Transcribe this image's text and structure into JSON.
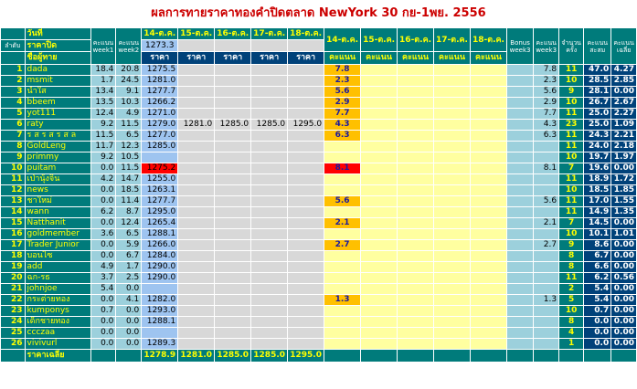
{
  "title": "ผลการทายราคาทองคำปิดตลาด NewYork 30 กย-1พย. 2556",
  "labels": {
    "order": "ลำดับ",
    "day": "วันที่",
    "close_price": "ราคาปิด",
    "player_name": "ชื่อผู้ทาย",
    "score_week1": "คะแนน week1",
    "score_week2": "คะแนน week2",
    "score_week3": "คะแนน week3",
    "bonus_week3": "Bonus week3",
    "count": "จำนวนครั้ง",
    "total": "คะแนนสะสม",
    "average": "คะแนนเฉลี่ย",
    "price": "ราคา",
    "score": "คะแนน",
    "avg_price": "ราคาเฉลี่ย"
  },
  "price_dates": [
    "14-ต.ค.",
    "15-ต.ค.",
    "16-ต.ค.",
    "17-ต.ค.",
    "18-ต.ค."
  ],
  "score_dates": [
    "14-ต.ค.",
    "15-ต.ค.",
    "16-ต.ค.",
    "17-ต.ค.",
    "18-ต.ค."
  ],
  "close_prices": [
    "1273.3",
    "",
    "",
    "",
    ""
  ],
  "avg_prices": [
    "1278.9",
    "1281.0",
    "1285.0",
    "1285.0",
    "1295.0"
  ],
  "rows": [
    {
      "no": "1",
      "name": "dada",
      "w1": "18.4",
      "w2": "20.8",
      "p": [
        "1275.5",
        "",
        "",
        "",
        ""
      ],
      "s": [
        "7.8",
        "",
        "",
        "",
        ""
      ],
      "bonus": "",
      "w3": "7.8",
      "cnt": "11",
      "total": "47.0",
      "avg": "4.27"
    },
    {
      "no": "2",
      "name": "msmit",
      "w1": "1.7",
      "w2": "24.5",
      "p": [
        "1281.0",
        "",
        "",
        "",
        ""
      ],
      "s": [
        "2.3",
        "",
        "",
        "",
        ""
      ],
      "bonus": "",
      "w3": "2.3",
      "cnt": "10",
      "total": "28.5",
      "avg": "2.85"
    },
    {
      "no": "3",
      "name": "น้ำใส",
      "w1": "13.4",
      "w2": "9.1",
      "p": [
        "1277.7",
        "",
        "",
        "",
        ""
      ],
      "s": [
        "5.6",
        "",
        "",
        "",
        ""
      ],
      "bonus": "",
      "w3": "5.6",
      "cnt": "9",
      "total": "28.1",
      "avg": "0.00"
    },
    {
      "no": "4",
      "name": "bbeem",
      "w1": "13.5",
      "w2": "10.3",
      "p": [
        "1266.2",
        "",
        "",
        "",
        ""
      ],
      "s": [
        "2.9",
        "",
        "",
        "",
        ""
      ],
      "bonus": "",
      "w3": "2.9",
      "cnt": "10",
      "total": "26.7",
      "avg": "2.67"
    },
    {
      "no": "5",
      "name": "yot111",
      "w1": "12.4",
      "w2": "4.9",
      "p": [
        "1271.0",
        "",
        "",
        "",
        ""
      ],
      "s": [
        "7.7",
        "",
        "",
        "",
        ""
      ],
      "bonus": "",
      "w3": "7.7",
      "cnt": "11",
      "total": "25.0",
      "avg": "2.27"
    },
    {
      "no": "6",
      "name": "raty",
      "w1": "9.2",
      "w2": "11.5",
      "p": [
        "1279.0",
        "1281.0",
        "1285.0",
        "1285.0",
        "1295.0"
      ],
      "s": [
        "4.3",
        "",
        "",
        "",
        ""
      ],
      "bonus": "",
      "w3": "4.3",
      "cnt": "23",
      "total": "25.0",
      "avg": "1.09"
    },
    {
      "no": "7",
      "name": "ร ส ร ส ร ส ล",
      "w1": "11.5",
      "w2": "6.5",
      "p": [
        "1277.0",
        "",
        "",
        "",
        ""
      ],
      "s": [
        "6.3",
        "",
        "",
        "",
        ""
      ],
      "bonus": "",
      "w3": "6.3",
      "cnt": "11",
      "total": "24.3",
      "avg": "2.21"
    },
    {
      "no": "8",
      "name": "GoldLeng",
      "w1": "11.7",
      "w2": "12.3",
      "p": [
        "1285.0",
        "",
        "",
        "",
        ""
      ],
      "s": [
        "",
        "",
        "",
        "",
        ""
      ],
      "bonus": "",
      "w3": "",
      "cnt": "11",
      "total": "24.0",
      "avg": "2.18"
    },
    {
      "no": "9",
      "name": "primmy",
      "w1": "9.2",
      "w2": "10.5",
      "p": [
        "",
        "",
        "",
        "",
        ""
      ],
      "s": [
        "",
        "",
        "",
        "",
        ""
      ],
      "bonus": "",
      "w3": "",
      "cnt": "10",
      "total": "19.7",
      "avg": "1.97"
    },
    {
      "no": "10",
      "name": "puitam",
      "w1": "0.0",
      "w2": "11.5",
      "p": [
        "1275.2",
        "",
        "",
        "",
        ""
      ],
      "s": [
        "8.1",
        "",
        "",
        "",
        ""
      ],
      "bonus": "",
      "w3": "8.1",
      "cnt": "7",
      "total": "19.6",
      "avg": "0.00",
      "hl": true
    },
    {
      "no": "11",
      "name": "เป่านุ้งจิ้น",
      "w1": "4.2",
      "w2": "14.7",
      "p": [
        "1255.0",
        "",
        "",
        "",
        ""
      ],
      "s": [
        "",
        "",
        "",
        "",
        ""
      ],
      "bonus": "",
      "w3": "",
      "cnt": "11",
      "total": "18.9",
      "avg": "1.72"
    },
    {
      "no": "12",
      "name": "news",
      "w1": "0.0",
      "w2": "18.5",
      "p": [
        "1263.1",
        "",
        "",
        "",
        ""
      ],
      "s": [
        "",
        "",
        "",
        "",
        ""
      ],
      "bonus": "",
      "w3": "",
      "cnt": "10",
      "total": "18.5",
      "avg": "1.85"
    },
    {
      "no": "13",
      "name": "ชาใหม่",
      "w1": "0.0",
      "w2": "11.4",
      "p": [
        "1277.7",
        "",
        "",
        "",
        ""
      ],
      "s": [
        "5.6",
        "",
        "",
        "",
        ""
      ],
      "bonus": "",
      "w3": "5.6",
      "cnt": "11",
      "total": "17.0",
      "avg": "1.55"
    },
    {
      "no": "14",
      "name": "wann",
      "w1": "6.2",
      "w2": "8.7",
      "p": [
        "1295.0",
        "",
        "",
        "",
        ""
      ],
      "s": [
        "",
        "",
        "",
        "",
        ""
      ],
      "bonus": "",
      "w3": "",
      "cnt": "11",
      "total": "14.9",
      "avg": "1.35"
    },
    {
      "no": "15",
      "name": "Natthanit",
      "w1": "0.0",
      "w2": "12.4",
      "p": [
        "1265.4",
        "",
        "",
        "",
        ""
      ],
      "s": [
        "2.1",
        "",
        "",
        "",
        ""
      ],
      "bonus": "",
      "w3": "2.1",
      "cnt": "7",
      "total": "14.5",
      "avg": "0.00"
    },
    {
      "no": "16",
      "name": "goldmember",
      "w1": "3.6",
      "w2": "6.5",
      "p": [
        "1288.1",
        "",
        "",
        "",
        ""
      ],
      "s": [
        "",
        "",
        "",
        "",
        ""
      ],
      "bonus": "",
      "w3": "",
      "cnt": "10",
      "total": "10.1",
      "avg": "1.01"
    },
    {
      "no": "17",
      "name": "Trader Junior",
      "w1": "0.0",
      "w2": "5.9",
      "p": [
        "1266.0",
        "",
        "",
        "",
        ""
      ],
      "s": [
        "2.7",
        "",
        "",
        "",
        ""
      ],
      "bonus": "",
      "w3": "2.7",
      "cnt": "9",
      "total": "8.6",
      "avg": "0.00"
    },
    {
      "no": "18",
      "name": "บอนไซ",
      "w1": "0.0",
      "w2": "6.7",
      "p": [
        "1284.0",
        "",
        "",
        "",
        ""
      ],
      "s": [
        "",
        "",
        "",
        "",
        ""
      ],
      "bonus": "",
      "w3": "",
      "cnt": "8",
      "total": "6.7",
      "avg": "0.00"
    },
    {
      "no": "19",
      "name": "add",
      "w1": "4.9",
      "w2": "1.7",
      "p": [
        "1290.0",
        "",
        "",
        "",
        ""
      ],
      "s": [
        "",
        "",
        "",
        "",
        ""
      ],
      "bonus": "",
      "w3": "",
      "cnt": "8",
      "total": "6.6",
      "avg": "0.00"
    },
    {
      "no": "20",
      "name": "ฉก-รธ",
      "w1": "3.7",
      "w2": "2.5",
      "p": [
        "1290.0",
        "",
        "",
        "",
        ""
      ],
      "s": [
        "",
        "",
        "",
        "",
        ""
      ],
      "bonus": "",
      "w3": "",
      "cnt": "11",
      "total": "6.2",
      "avg": "0.56"
    },
    {
      "no": "21",
      "name": "johnjoe",
      "w1": "5.4",
      "w2": "0.0",
      "p": [
        "",
        "",
        "",
        "",
        ""
      ],
      "s": [
        "",
        "",
        "",
        "",
        ""
      ],
      "bonus": "",
      "w3": "",
      "cnt": "2",
      "total": "5.4",
      "avg": "0.00"
    },
    {
      "no": "22",
      "name": "กระต่ายทอง",
      "w1": "0.0",
      "w2": "4.1",
      "p": [
        "1282.0",
        "",
        "",
        "",
        ""
      ],
      "s": [
        "1.3",
        "",
        "",
        "",
        ""
      ],
      "bonus": "",
      "w3": "1.3",
      "cnt": "5",
      "total": "5.4",
      "avg": "0.00"
    },
    {
      "no": "23",
      "name": "kumponys",
      "w1": "0.7",
      "w2": "0.0",
      "p": [
        "1293.0",
        "",
        "",
        "",
        ""
      ],
      "s": [
        "",
        "",
        "",
        "",
        ""
      ],
      "bonus": "",
      "w3": "",
      "cnt": "10",
      "total": "0.7",
      "avg": "0.00"
    },
    {
      "no": "24",
      "name": "เด็กชายทอง",
      "w1": "0.0",
      "w2": "0.0",
      "p": [
        "1288.1",
        "",
        "",
        "",
        ""
      ],
      "s": [
        "",
        "",
        "",
        "",
        ""
      ],
      "bonus": "",
      "w3": "",
      "cnt": "8",
      "total": "0.0",
      "avg": "0.00"
    },
    {
      "no": "25",
      "name": "ccczaa",
      "w1": "0.0",
      "w2": "0.0",
      "p": [
        "",
        "",
        "",
        "",
        ""
      ],
      "s": [
        "",
        "",
        "",
        "",
        ""
      ],
      "bonus": "",
      "w3": "",
      "cnt": "4",
      "total": "0.0",
      "avg": "0.00"
    },
    {
      "no": "26",
      "name": "vivivurl",
      "w1": "0.0",
      "w2": "0.0",
      "p": [
        "1289.3",
        "",
        "",
        "",
        ""
      ],
      "s": [
        "",
        "",
        "",
        "",
        ""
      ],
      "bonus": "",
      "w3": "",
      "cnt": "1",
      "total": "0.0",
      "avg": "0.00"
    }
  ],
  "colors": {
    "teal": "#007b7b",
    "name_yellow": "#ffff00",
    "price_blue": "#9ec4f0",
    "score_yellow": "#ffffa0",
    "score_orange": "#ffc000",
    "highlight_red": "#ff0000",
    "total_navy": "#00427a"
  }
}
